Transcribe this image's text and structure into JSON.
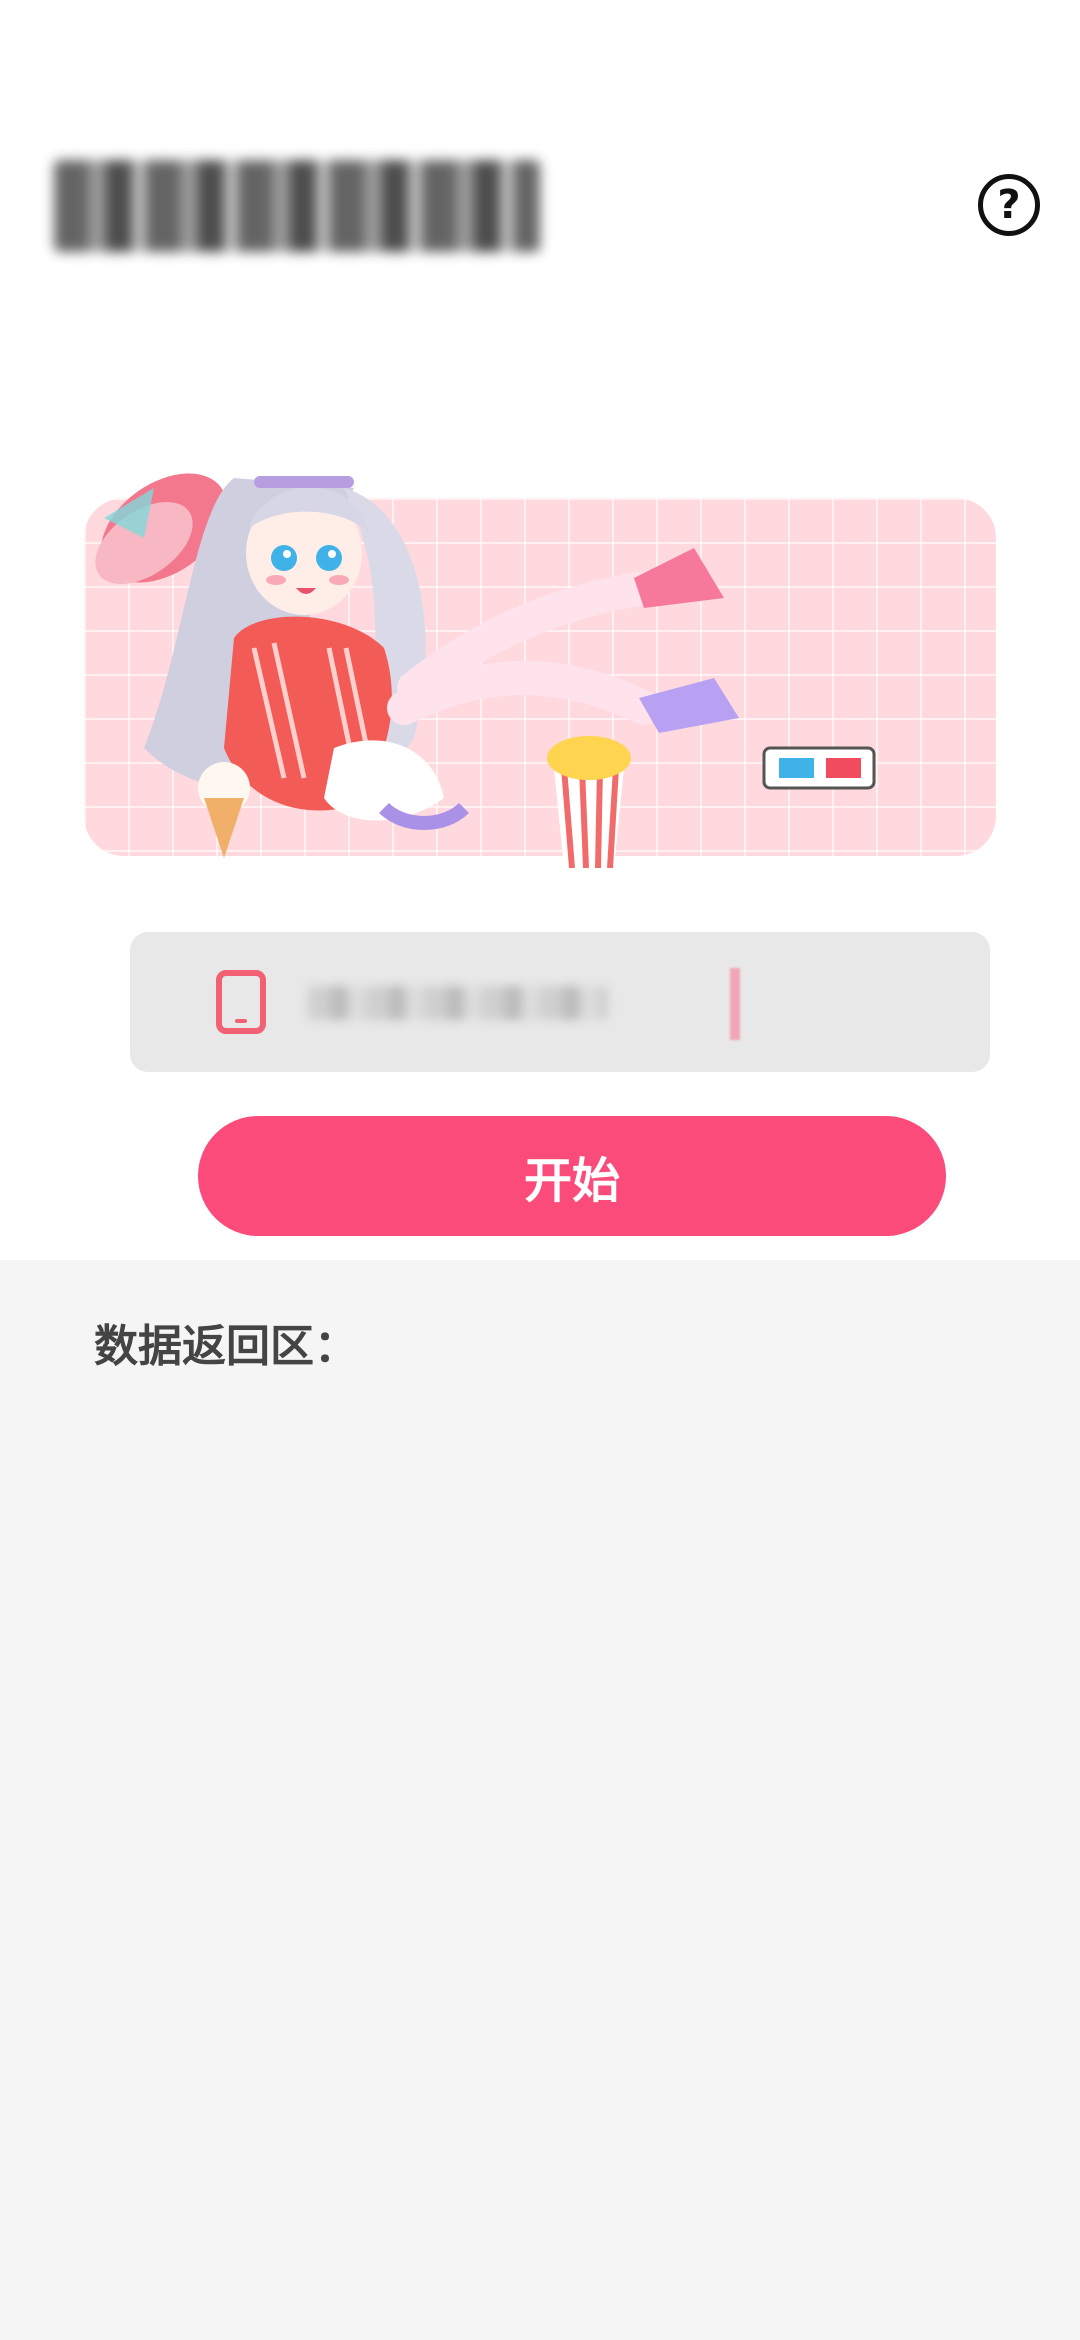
{
  "header": {
    "help_symbol": "?",
    "help_icon": "question-circle-icon"
  },
  "banner": {
    "illustration": "anime-girl-popcorn-illustration",
    "bg_color": "#ffd9de"
  },
  "phone_input": {
    "icon": "phone-icon",
    "value": ""
  },
  "actions": {
    "start_label": "开始",
    "start_color": "#fb4b7a"
  },
  "result_area": {
    "label": "数据返回区："
  }
}
